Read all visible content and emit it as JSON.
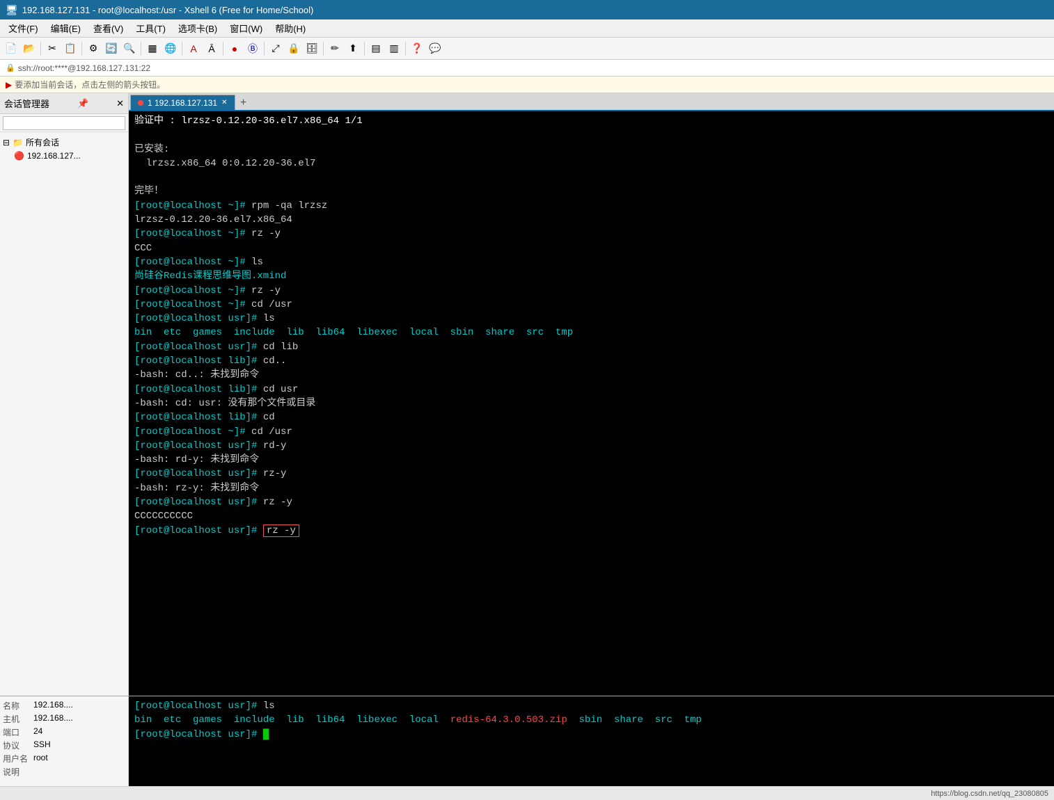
{
  "titleBar": {
    "icon": "🖥",
    "title": "192.168.127.131 - root@localhost:/usr - Xshell 6 (Free for Home/School)"
  },
  "menuBar": {
    "items": [
      "文件(F)",
      "编辑(E)",
      "查看(V)",
      "工具(T)",
      "选项卡(B)",
      "窗口(W)",
      "帮助(H)"
    ]
  },
  "addressBar": {
    "text": "ssh://root:****@192.168.127.131:22"
  },
  "infoBar": {
    "text": "要添加当前会话，点击左侧的箭头按钮。"
  },
  "sidebar": {
    "header": "会话管理器",
    "searchPlaceholder": "",
    "rootLabel": "所有会话",
    "childLabel": "192.168.127..."
  },
  "tab": {
    "label": "1 192.168.127.131",
    "addLabel": "+"
  },
  "terminal": {
    "lines": [
      {
        "type": "normal",
        "text": "验证中        : lrzsz-0.12.20-36.el7.x86_64                               1/1"
      },
      {
        "type": "blank"
      },
      {
        "type": "normal",
        "text": "已安装:"
      },
      {
        "type": "normal",
        "text": "  lrzsz.x86_64 0:0.12.20-36.el7"
      },
      {
        "type": "blank"
      },
      {
        "type": "normal",
        "text": "完毕！"
      },
      {
        "type": "prompt",
        "prompt": "[root@localhost ~]# ",
        "cmd": "rpm -qa lrzsz"
      },
      {
        "type": "normal",
        "text": "lrzsz-0.12.20-36.el7.x86_64"
      },
      {
        "type": "prompt",
        "prompt": "[root@localhost ~]# ",
        "cmd": "rz -y"
      },
      {
        "type": "normal",
        "text": "CCC"
      },
      {
        "type": "prompt",
        "prompt": "[root@localhost ~]# ",
        "cmd": "ls"
      },
      {
        "type": "cyan",
        "text": "尚硅谷Redis课程思维导图.xmind"
      },
      {
        "type": "prompt",
        "prompt": "[root@localhost ~]# ",
        "cmd": "rz -y"
      },
      {
        "type": "prompt",
        "prompt": "[root@localhost ~]# ",
        "cmd": "cd /usr"
      },
      {
        "type": "prompt",
        "prompt": "[root@localhost usr]# ",
        "cmd": "ls"
      },
      {
        "type": "dir-list",
        "text": "bin  etc  games  include  lib  lib64  libexec  local  sbin  share  src  tmp"
      },
      {
        "type": "prompt",
        "prompt": "[root@localhost usr]# ",
        "cmd": "cd lib"
      },
      {
        "type": "prompt",
        "prompt": "[root@localhost lib]# ",
        "cmd": "cd.."
      },
      {
        "type": "error",
        "text": "-bash: cd..: 未找到命令"
      },
      {
        "type": "prompt",
        "prompt": "[root@localhost lib]# ",
        "cmd": "cd usr"
      },
      {
        "type": "error",
        "text": "-bash: cd: usr: 没有那个文件或目录"
      },
      {
        "type": "prompt",
        "prompt": "[root@localhost lib]# ",
        "cmd": "cd"
      },
      {
        "type": "prompt",
        "prompt": "[root@localhost ~]# ",
        "cmd": "cd /usr"
      },
      {
        "type": "prompt",
        "prompt": "[root@localhost usr]# ",
        "cmd": "rd-y"
      },
      {
        "type": "error",
        "text": "-bash: rd-y: 未找到命令"
      },
      {
        "type": "prompt",
        "prompt": "[root@localhost usr]# ",
        "cmd": "rz-y"
      },
      {
        "type": "error",
        "text": "-bash: rz-y: 未找到命令"
      },
      {
        "type": "prompt",
        "prompt": "[root@localhost usr]# ",
        "cmd": "rz -y"
      },
      {
        "type": "normal",
        "text": "CCCCCCCCCC"
      },
      {
        "type": "prompt-highlight",
        "prompt": "[root@localhost usr]# ",
        "cmd": "rz -y"
      }
    ]
  },
  "bottomTerminal": {
    "lines": [
      {
        "type": "prompt",
        "prompt": "[root@localhost usr]# ",
        "cmd": "ls"
      },
      {
        "type": "dir-list2",
        "text": "bin  etc  games  include  lib  lib64  libexec  local  ",
        "highlight": "redis-64.3.0.503.zip",
        "rest": "  sbin  share  src  tmp"
      },
      {
        "type": "prompt",
        "prompt": "[root@localhost usr]# ",
        "cmd": "█"
      }
    ]
  },
  "bottomInfo": {
    "rows": [
      {
        "label": "名称",
        "value": "192.168...."
      },
      {
        "label": "主机",
        "value": "192.168...."
      },
      {
        "label": "端口",
        "value": "24"
      },
      {
        "label": "协议",
        "value": "SSH"
      },
      {
        "label": "用户名",
        "value": "root"
      },
      {
        "label": "说明",
        "value": ""
      }
    ]
  },
  "statusBar": {
    "url": "https://blog.csdn.net/qq_23080805"
  }
}
